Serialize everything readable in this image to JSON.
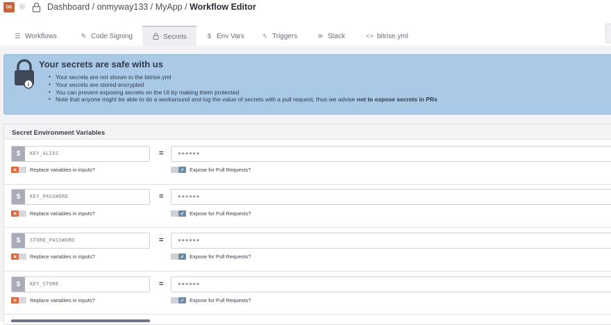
{
  "header": {
    "org_badge": "GE",
    "breadcrumb": {
      "dashboard": "Dashboard",
      "owner": "onmyway133",
      "app": "MyApp",
      "current": "Workflow Editor",
      "separator": "/"
    }
  },
  "tabs": [
    {
      "label": "Workflows",
      "icon": "list-icon"
    },
    {
      "label": "Code Signing",
      "icon": "edit-icon"
    },
    {
      "label": "Secrets",
      "icon": "lock-icon",
      "active": true
    },
    {
      "label": "Env Vars",
      "icon": "dollar-icon"
    },
    {
      "label": "Triggers",
      "icon": "bolt-icon"
    },
    {
      "label": "Stack",
      "icon": "stack-icon"
    },
    {
      "label": "bitrise.yml",
      "icon": "code-icon"
    }
  ],
  "banner": {
    "title": "Your secrets are safe with us",
    "items": [
      "Your secrets are not shown in the bitrise.yml",
      "Your secrets are stored encrypted",
      "You can prevent exposing secrets on the UI by making them protected"
    ],
    "note_prefix": "Note that anyone might be able to do a workaround and log the value of secrets with a pull request, thus we advise ",
    "note_bold": "not to expose secrets in PRs"
  },
  "panel": {
    "title": "Secret Environment Variables",
    "equals": "=",
    "dollar": "$",
    "replace_label": "Replace variables in inputs?",
    "expose_label": "Expose for Pull Requests?",
    "secrets": [
      {
        "key": "KEY_ALIAS",
        "value": "******",
        "replace": false,
        "expose": true
      },
      {
        "key": "KEY_PASSWORD",
        "value": "******",
        "replace": false,
        "expose": true
      },
      {
        "key": "STORE_PASSWORD",
        "value": "******",
        "replace": false,
        "expose": true
      },
      {
        "key": "KEY_STORE",
        "value": "******",
        "replace": false,
        "expose": true
      }
    ]
  },
  "colors": {
    "banner_bg": "#a9c9e6",
    "toggle_off": "#d9693f",
    "toggle_on": "#6c8aa3",
    "org_badge": "#c9643a"
  }
}
